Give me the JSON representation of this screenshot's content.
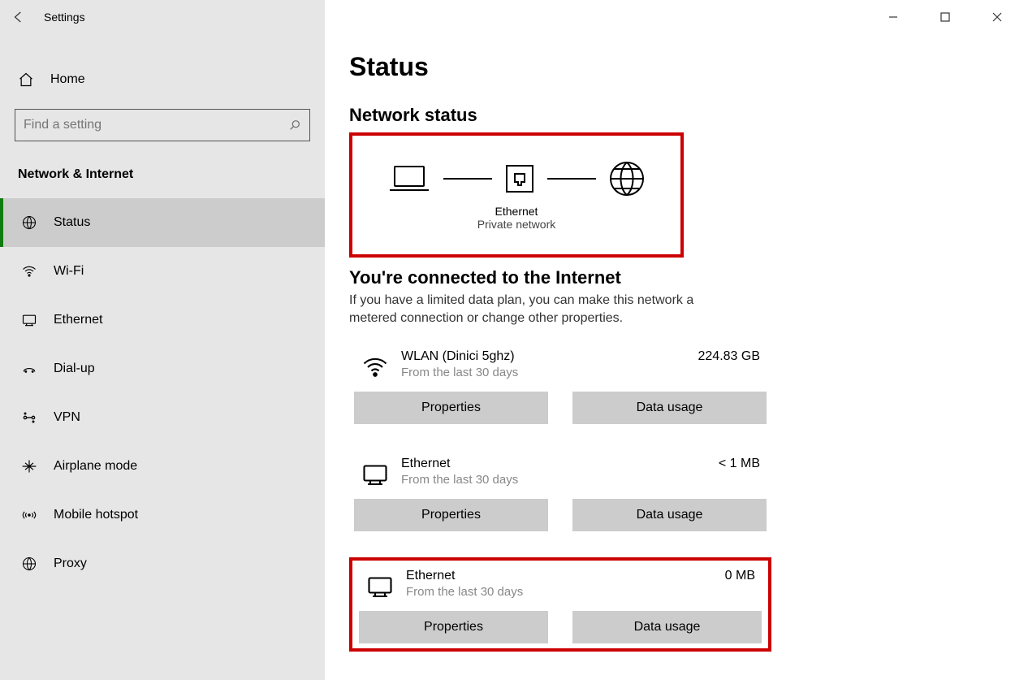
{
  "app_title": "Settings",
  "home_label": "Home",
  "search": {
    "placeholder": "Find a setting"
  },
  "category": "Network & Internet",
  "nav": [
    {
      "key": "status",
      "label": "Status",
      "icon": "globe-icon",
      "selected": true
    },
    {
      "key": "wifi",
      "label": "Wi-Fi",
      "icon": "wifi-icon",
      "selected": false
    },
    {
      "key": "ethernet",
      "label": "Ethernet",
      "icon": "ethernet-icon",
      "selected": false
    },
    {
      "key": "dialup",
      "label": "Dial-up",
      "icon": "dialup-icon",
      "selected": false
    },
    {
      "key": "vpn",
      "label": "VPN",
      "icon": "vpn-icon",
      "selected": false
    },
    {
      "key": "airplane",
      "label": "Airplane mode",
      "icon": "airplane-icon",
      "selected": false
    },
    {
      "key": "hotspot",
      "label": "Mobile hotspot",
      "icon": "hotspot-icon",
      "selected": false
    },
    {
      "key": "proxy",
      "label": "Proxy",
      "icon": "proxy-globe-icon",
      "selected": false
    }
  ],
  "page": {
    "title": "Status",
    "section_title": "Network status",
    "diagram": {
      "adapter_label": "Ethernet",
      "network_type": "Private network"
    },
    "connected_heading": "You're connected to the Internet",
    "connected_body": "If you have a limited data plan, you can make this network a metered connection or change other properties.",
    "adapters": [
      {
        "icon": "wifi-icon",
        "name": "WLAN (Dinici 5ghz)",
        "sub": "From the last 30 days",
        "usage": "224.83 GB",
        "highlight": false
      },
      {
        "icon": "ethernet-icon",
        "name": "Ethernet",
        "sub": "From the last 30 days",
        "usage": "< 1 MB",
        "highlight": false
      },
      {
        "icon": "ethernet-icon",
        "name": "Ethernet",
        "sub": "From the last 30 days",
        "usage": "0 MB",
        "highlight": true
      }
    ],
    "btn_properties": "Properties",
    "btn_data_usage": "Data usage"
  }
}
